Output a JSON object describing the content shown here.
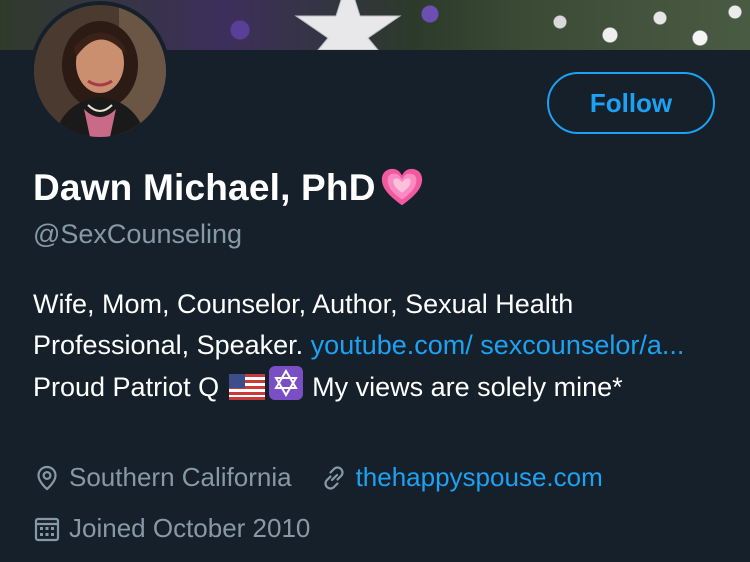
{
  "profile": {
    "name": "Dawn Michael, PhD",
    "handle": "@SexCounseling",
    "follow_label": "Follow",
    "bio": {
      "text1": "Wife, Mom, Counselor, Author, Sexual Health Professional, Speaker. ",
      "link": "youtube.com/ sexcounselor/a...",
      "text2": " Proud Patriot Q ",
      "text3": " My views are solely mine*"
    },
    "location": "Southern California",
    "website": "thehappyspouse.com",
    "joined": "Joined October 2010"
  },
  "icons": {
    "name_emoji": "growing-heart-icon",
    "flag": "us-flag-icon",
    "star": "star-of-david-icon",
    "location": "location-pin-icon",
    "link": "link-icon",
    "calendar": "calendar-icon"
  },
  "colors": {
    "background": "#15202b",
    "accent": "#1da1f2",
    "secondary_text": "#8899a6"
  }
}
